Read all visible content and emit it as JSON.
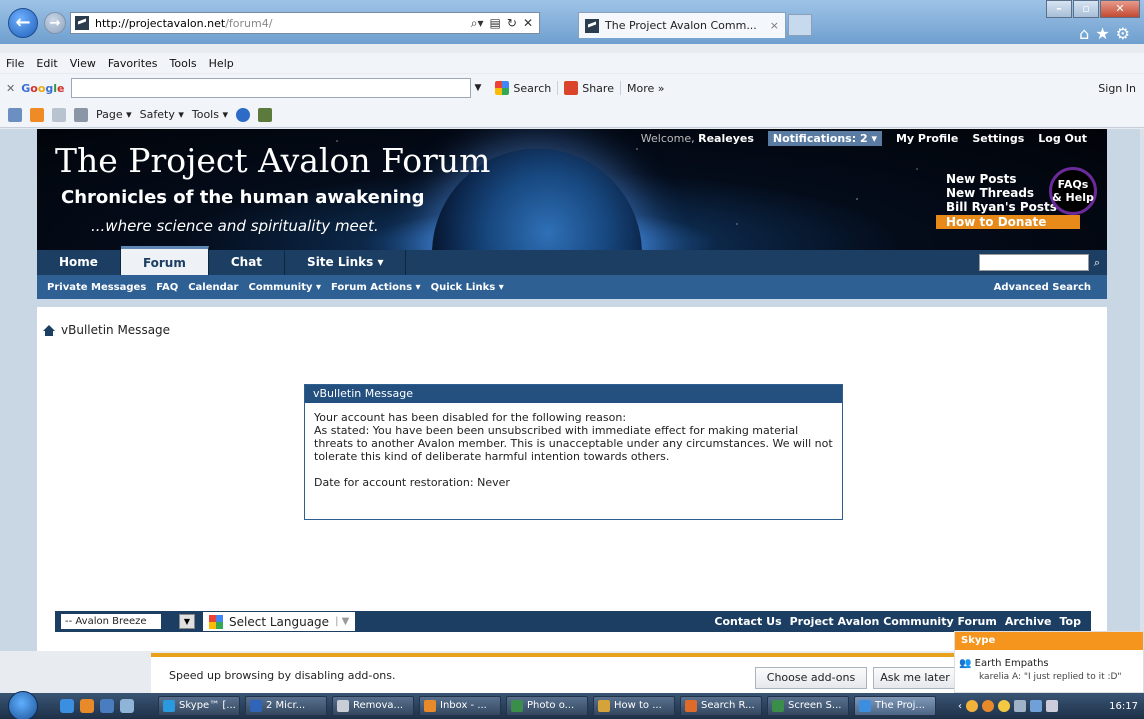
{
  "browser": {
    "address": {
      "host": "http://projectavalon.net",
      "path": "/forum4/"
    },
    "tab_title": "The Project Avalon Comm...",
    "tab_close": "×",
    "menu": [
      "File",
      "Edit",
      "View",
      "Favorites",
      "Tools",
      "Help"
    ],
    "google": {
      "logo": "Google",
      "search_label": "Search",
      "share_label": "Share",
      "more_label": "More »",
      "signin": "Sign In"
    },
    "cmdbar": [
      "Page ▾",
      "Safety ▾",
      "Tools ▾"
    ]
  },
  "site": {
    "title": "The Project Avalon Forum",
    "tagline": "Chronicles of the human awakening",
    "subtitle": "...where science and spirituality meet.",
    "welcome": "Welcome,",
    "username": "Realeyes",
    "notifications": "Notifications: 2 ▾",
    "user_links": [
      "My Profile",
      "Settings",
      "Log Out"
    ],
    "quick_links": [
      "New Posts",
      "New Threads",
      "Bill Ryan's Posts"
    ],
    "donate": "How to Donate",
    "faq_line1": "FAQs",
    "faq_line2": "& Help"
  },
  "navbar": {
    "tabs": [
      {
        "label": "Home",
        "active": false
      },
      {
        "label": "Forum",
        "active": true
      },
      {
        "label": "Chat",
        "active": false
      },
      {
        "label": "Site Links ▾",
        "active": false
      }
    ],
    "subnav": [
      "Private Messages",
      "FAQ",
      "Calendar",
      "Community ▾",
      "Forum Actions ▾",
      "Quick Links ▾"
    ],
    "advanced_search": "Advanced Search"
  },
  "breadcrumb": "vBulletin Message",
  "message": {
    "header": "vBulletin Message",
    "line1": "Your account has been disabled for the following reason:",
    "reason": "As stated: You have been been unsubscribed with immediate effect for making material threats to another Avalon member. This is unacceptable under any circumstances. We will not tolerate this kind of deliberate harmful intention towards others.",
    "restoration": "Date for account restoration: Never"
  },
  "footer": {
    "style": "-- Avalon Breeze",
    "translate": "Select Language",
    "links": [
      "Contact Us",
      "Project Avalon Community Forum",
      "Archive",
      "Top"
    ]
  },
  "notification_bar": {
    "text": "Speed up browsing by disabling add-ons.",
    "choose": "Choose add-ons",
    "later": "Ask me later"
  },
  "skype_popup": {
    "app": "Skype",
    "group": "Earth Empaths",
    "message": "karelia A: \"I just replied to it :D\""
  },
  "taskbar": {
    "items": [
      "Skype™ [...",
      "2 Micr...",
      "Remova...",
      "Inbox - ...",
      "Photo o...",
      "How to ...",
      "Search R...",
      "Screen S...",
      "The Proj..."
    ],
    "clock": "16:17"
  }
}
